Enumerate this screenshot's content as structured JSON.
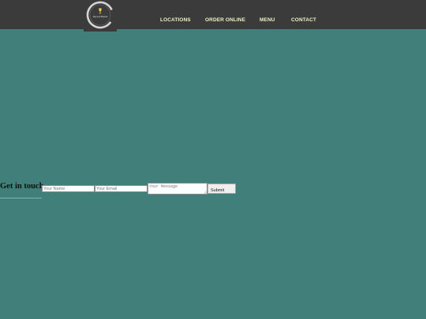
{
  "header": {
    "logo": {
      "name": "Sip and Bigsta",
      "icon": "wine-glass-icon",
      "ring_color": "#d9d9d9",
      "accent_color": "#e9d35a"
    },
    "nav": [
      {
        "label": "LOCATIONS"
      },
      {
        "label": "ORDER ONLINE"
      },
      {
        "label": "MENU"
      },
      {
        "label": "CONTACT"
      }
    ],
    "bar_color": "#3b3b3b",
    "nav_color": "#e8f3bf"
  },
  "page": {
    "background": "#41807a"
  },
  "contact": {
    "heading": "Get in touch",
    "name_placeholder": "Your Name",
    "email_placeholder": "Your Email",
    "message_placeholder": "Your Message",
    "submit_label": "Submit"
  }
}
